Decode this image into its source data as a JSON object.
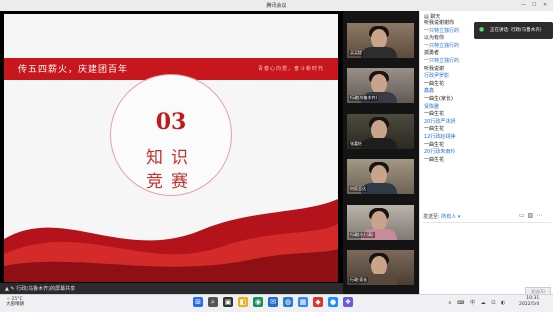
{
  "window": {
    "title": "腾讯会议",
    "controls": [
      "—",
      "☐",
      "✕"
    ]
  },
  "slide": {
    "banner_text": "传五四薪火，庆建团百年",
    "banner_sub": "青春心向党，奋斗新时代",
    "number": "03",
    "line1": "知识",
    "line2": "竞赛"
  },
  "share_status": "行政(乌鲁木齐)的屏幕共享",
  "participants": [
    {
      "name": "买买提"
    },
    {
      "name": "行政(乌鲁木齐)"
    },
    {
      "name": "张嘉怡"
    },
    {
      "name": "何家至达"
    },
    {
      "name": "行政(小) (高)"
    },
    {
      "name": "行政·家长"
    }
  ],
  "chat": {
    "title": "聊天",
    "messages": [
      {
        "text": "听我说谢谢你",
        "kind": "b"
      },
      {
        "text": "一只特立独行的",
        "kind": "n"
      },
      {
        "text": "以为有你",
        "kind": "b"
      },
      {
        "text": "一只特立独行的",
        "kind": "n"
      },
      {
        "text": "孤勇者",
        "kind": "b"
      },
      {
        "text": "一只特立独行的",
        "kind": "n"
      },
      {
        "text": "听我说谢",
        "kind": "b"
      },
      {
        "text": "行政尹罗影",
        "kind": "n"
      },
      {
        "text": "一曲生花",
        "kind": "b"
      },
      {
        "text": "鑫鑫",
        "kind": "n"
      },
      {
        "text": "一曲生(家长)",
        "kind": "b"
      },
      {
        "text": "贤陈雅",
        "kind": "n"
      },
      {
        "text": "一曲生花",
        "kind": "b"
      },
      {
        "text": "20行政严沐妍",
        "kind": "n"
      },
      {
        "text": "一曲生花",
        "kind": "b"
      },
      {
        "text": "12行政赵翊铮",
        "kind": "n"
      },
      {
        "text": "一曲生花",
        "kind": "b"
      },
      {
        "text": "20行政朱雨玲",
        "kind": "n"
      },
      {
        "text": "一曲生花",
        "kind": "b"
      }
    ],
    "send_to_label": "发送至:",
    "send_to_value": "所有人 ▾",
    "send_button": "发送(S)"
  },
  "toast": {
    "text": "正在讲话: 行政(乌鲁木齐)"
  },
  "taskbar": {
    "temperature": "25°C",
    "weather": "大部晴朗",
    "apps": [
      {
        "glyph": "⊞",
        "color": "#2b6de8"
      },
      {
        "glyph": "⌕",
        "color": "#555"
      },
      {
        "glyph": "▣",
        "color": "#333"
      },
      {
        "glyph": "◧",
        "color": "#e8b020"
      },
      {
        "glyph": "◉",
        "color": "#1d8f5a"
      },
      {
        "glyph": "✉",
        "color": "#1f6fd1"
      },
      {
        "glyph": "◍",
        "color": "#2a7bd6"
      },
      {
        "glyph": "▦",
        "color": "#3b83f0"
      },
      {
        "glyph": "◆",
        "color": "#d33"
      },
      {
        "glyph": "●",
        "color": "#1a8cff"
      },
      {
        "glyph": "❖",
        "color": "#6a5ad6"
      }
    ],
    "tray": "∧ ⌨ 中 ☁ ⊡ ◐",
    "time": "10:31",
    "date": "2022/5/4"
  }
}
